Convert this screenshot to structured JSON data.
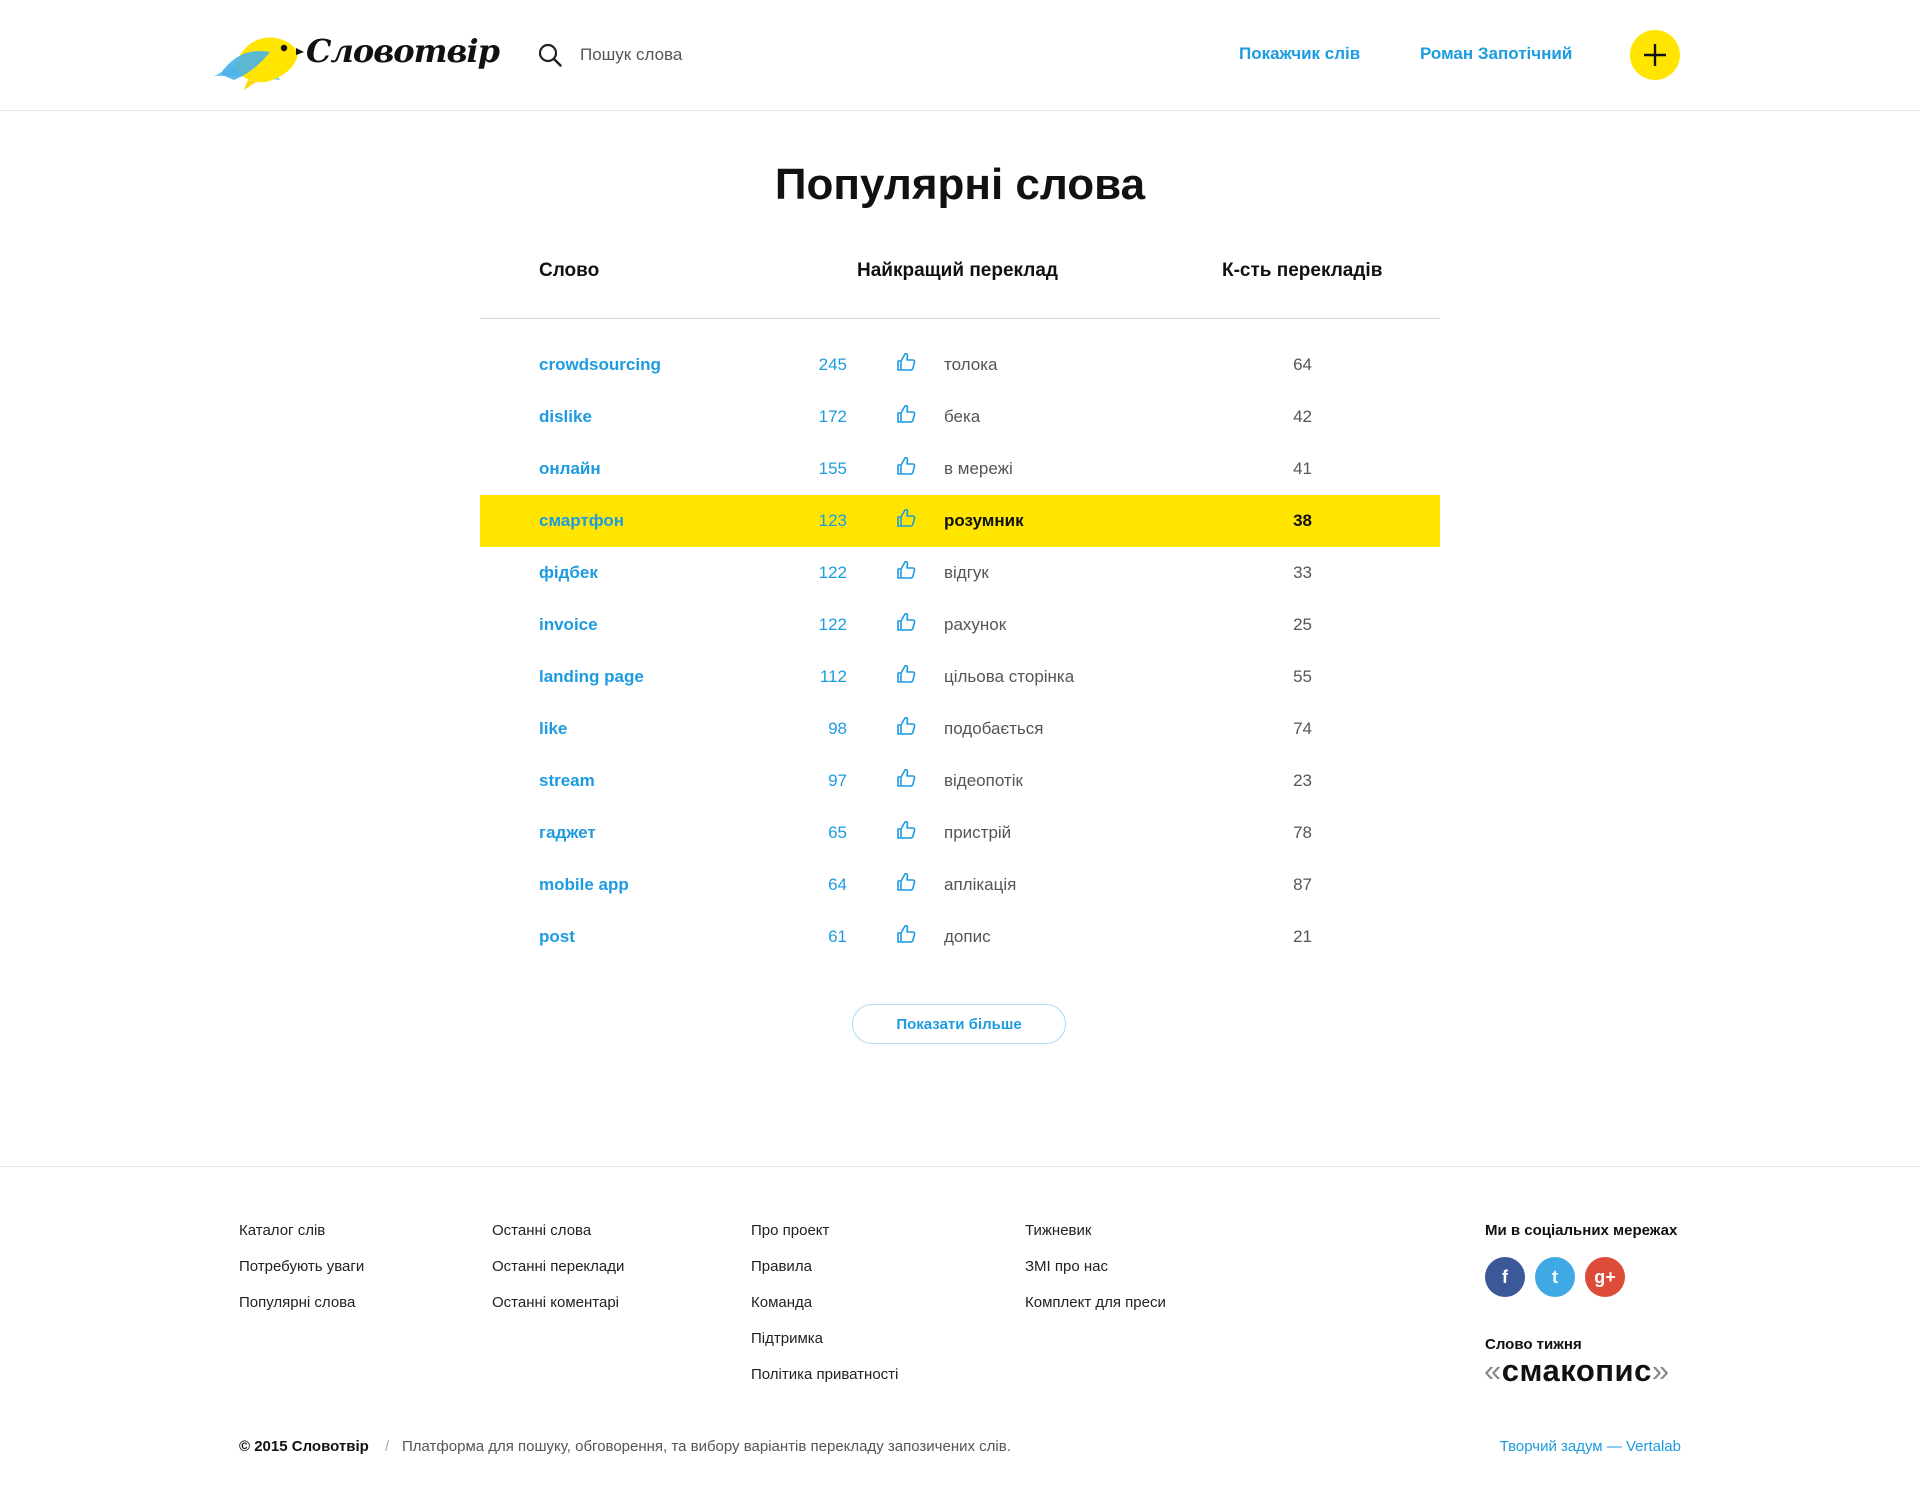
{
  "header": {
    "logo_text": "Словотвір",
    "search_placeholder": "Пошук слова",
    "nav_index": "Покажчик слів",
    "user_name": "Роман Запотічний"
  },
  "main": {
    "title": "Популярні слова",
    "columns": {
      "word": "Слово",
      "best": "Найкращий переклад",
      "count": "К-сть перекладів"
    },
    "rows": [
      {
        "word": "crowdsourcing",
        "votes": "245",
        "translation": "толока",
        "count": "64"
      },
      {
        "word": "dislike",
        "votes": "172",
        "translation": "бека",
        "count": "42"
      },
      {
        "word": "онлайн",
        "votes": "155",
        "translation": "в мережі",
        "count": "41"
      },
      {
        "word": "смартфон",
        "votes": "123",
        "translation": "розумник",
        "count": "38"
      },
      {
        "word": "фідбек",
        "votes": "122",
        "translation": "відгук",
        "count": "33"
      },
      {
        "word": "invoice",
        "votes": "122",
        "translation": "рахунок",
        "count": "25"
      },
      {
        "word": "landing page",
        "votes": "112",
        "translation": "цільова сторінка",
        "count": "55"
      },
      {
        "word": "like",
        "votes": "98",
        "translation": "подобається",
        "count": "74"
      },
      {
        "word": "stream",
        "votes": "97",
        "translation": "відеопотік",
        "count": "23"
      },
      {
        "word": "гаджет",
        "votes": "65",
        "translation": "пристрій",
        "count": "78"
      },
      {
        "word": "mobile app",
        "votes": "64",
        "translation": "аплікація",
        "count": "87"
      },
      {
        "word": "post",
        "votes": "61",
        "translation": "допис",
        "count": "21"
      }
    ],
    "more_button": "Показати більше"
  },
  "footer": {
    "col1": [
      "Каталог слів",
      "Потребують уваги",
      "Популярні слова"
    ],
    "col2": [
      "Останні слова",
      "Останні переклади",
      "Останні коментарі"
    ],
    "col3": [
      "Про проект",
      "Правила",
      "Команда",
      "Підтримка",
      "Політика приватності"
    ],
    "col4": [
      "Тижневик",
      "ЗМІ про нас",
      "Комплект для преси"
    ],
    "social_title": "Ми в соціальних мережах",
    "social": {
      "facebook": "f",
      "twitter": "t",
      "googleplus": "g+"
    },
    "word_of_week_title": "Слово тижня",
    "word_of_week_open": "«",
    "word_of_week": "смакопис",
    "word_of_week_close": "»",
    "copyright": "© 2015 Словотвір",
    "separator": "/",
    "tagline": "Платформа для пошуку, обговорення, та вибору варіантів перекладу запозичених слів.",
    "credit": "Творчий задум — Vertalab"
  },
  "colors": {
    "accent": "#1d9be0",
    "highlight": "#ffe500",
    "facebook": "#3b5998",
    "twitter": "#3fa9e6",
    "googleplus": "#dd4b39"
  },
  "highlighted_row_index": 3,
  "icons": [
    "bird-logo-icon",
    "search-icon",
    "plus-icon",
    "thumbs-up-icon",
    "facebook-icon",
    "twitter-icon",
    "google-plus-icon"
  ]
}
